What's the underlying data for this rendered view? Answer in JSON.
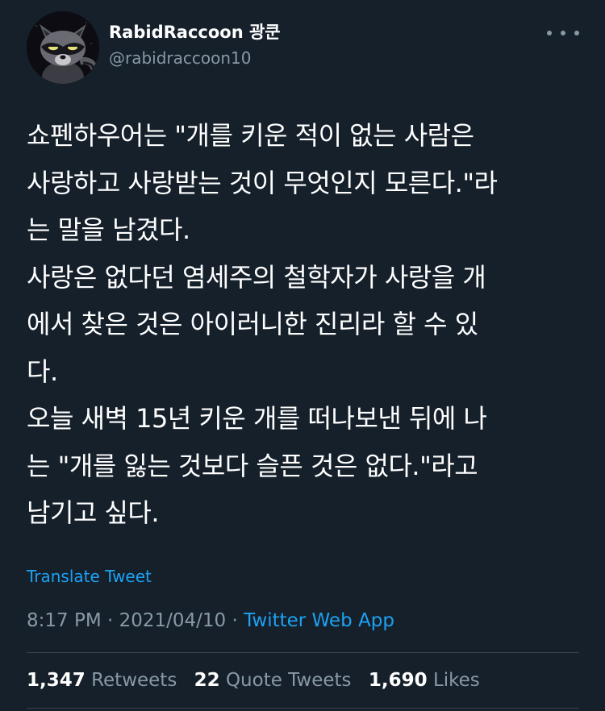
{
  "author": {
    "display_name": "RabidRaccoon 광쿤",
    "handle": "@rabidraccoon10"
  },
  "tweet": {
    "lines": [
      "쇼펜하우어는 \"개를 키운 적이 없는 사람은",
      "사랑하고 사랑받는 것이 무엇인지 모른다.\"라",
      "는 말을 남겼다.",
      "사랑은 없다던 염세주의 철학자가 사랑을 개",
      "에서 찾은 것은 아이러니한 진리라 할 수 있",
      "다.",
      "오늘 새벽 15년 키운 개를 떠나보낸 뒤에 나",
      "는 \"개를 잃는 것보다 슬픈 것은 없다.\"라고",
      "남기고 싶다."
    ],
    "translate_label": "Translate Tweet"
  },
  "meta": {
    "time": "8:17 PM",
    "separator": " · ",
    "date": "2021/04/10",
    "source": "Twitter Web App"
  },
  "stats": {
    "retweets_count": "1,347",
    "retweets_label": "Retweets",
    "quote_count": "22",
    "quote_label": "Quote Tweets",
    "likes_count": "1,690",
    "likes_label": "Likes"
  },
  "icons": {
    "more": "more-horizontal-icon",
    "avatar": "raccoon-avatar"
  },
  "colors": {
    "background": "#15202b",
    "text": "#ffffff",
    "secondary": "#8899a6",
    "accent": "#1da1f2",
    "divider": "#38444d"
  }
}
